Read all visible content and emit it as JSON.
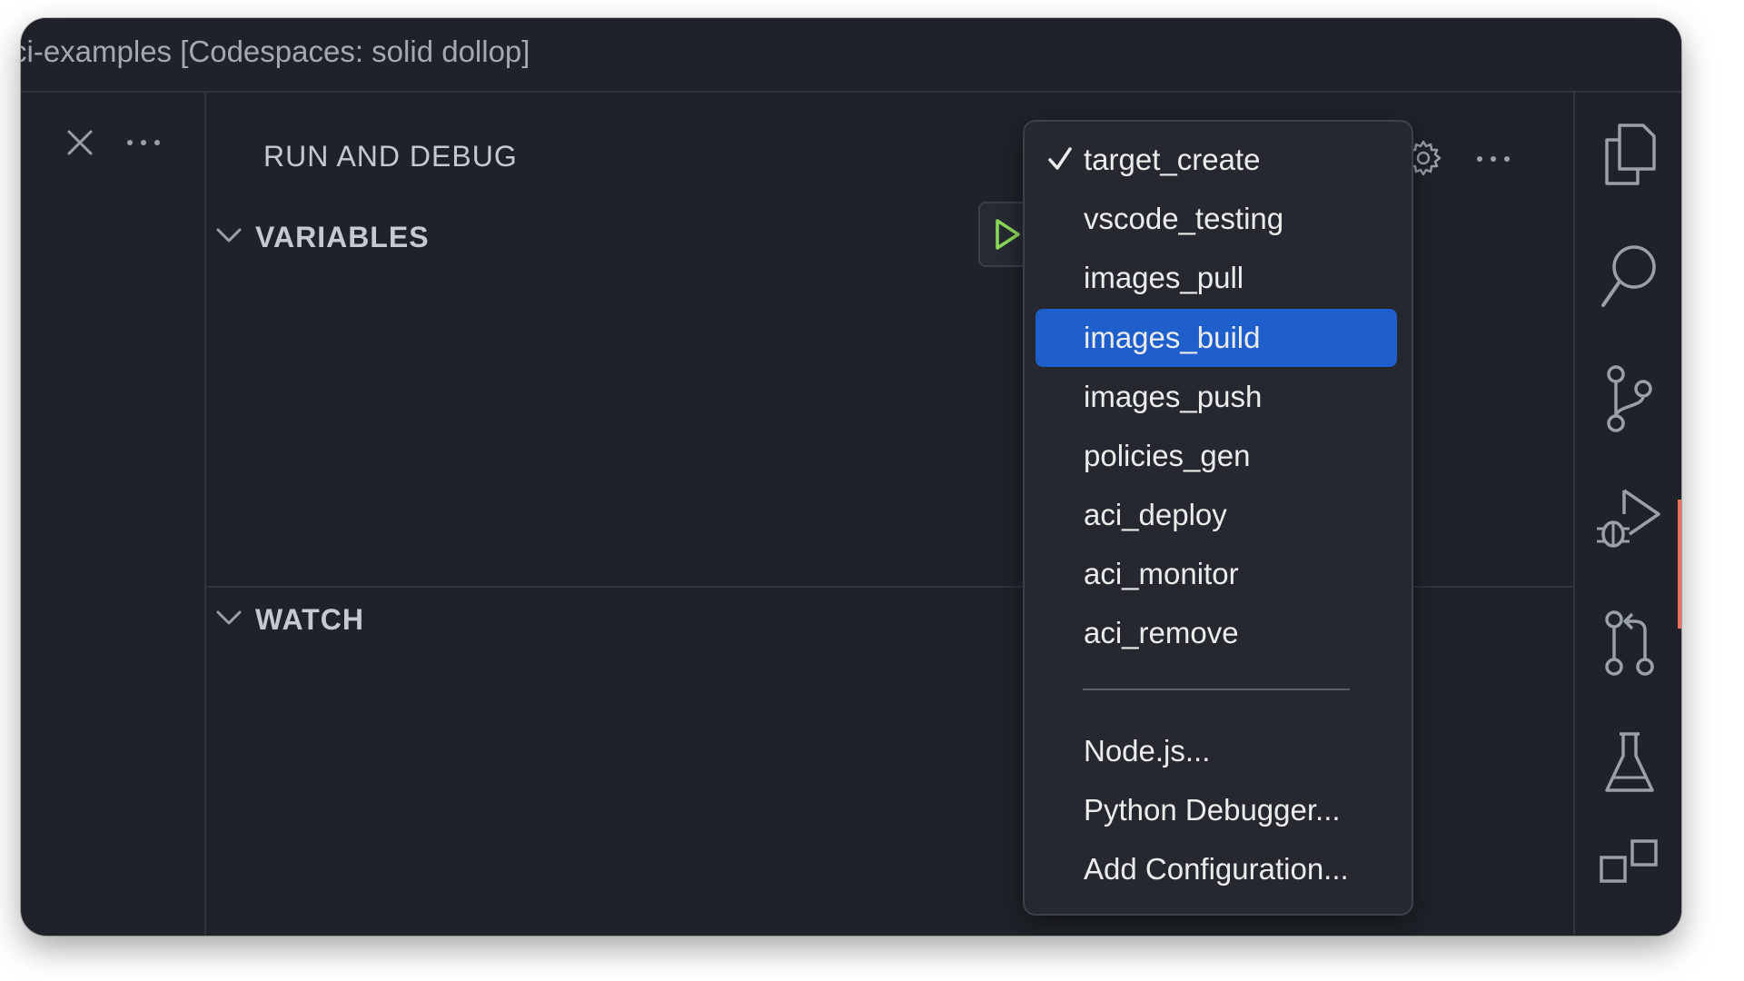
{
  "window": {
    "title": "ci-examples [Codespaces: solid dollop]"
  },
  "panel": {
    "title": "RUN AND DEBUG",
    "sections": [
      {
        "label": "VARIABLES",
        "expanded": true
      },
      {
        "label": "WATCH",
        "expanded": true
      }
    ]
  },
  "config_menu": {
    "checked_item": "target_create",
    "highlighted_item": "images_build",
    "items": [
      {
        "label": "target_create",
        "checked": true
      },
      {
        "label": "vscode_testing"
      },
      {
        "label": "images_pull"
      },
      {
        "label": "images_build",
        "highlighted": true
      },
      {
        "label": "images_push"
      },
      {
        "label": "policies_gen"
      },
      {
        "label": "aci_deploy"
      },
      {
        "label": "aci_monitor"
      },
      {
        "label": "aci_remove"
      }
    ],
    "extra_items": [
      {
        "label": "Node.js..."
      },
      {
        "label": "Python Debugger..."
      },
      {
        "label": "Add Configuration..."
      }
    ]
  },
  "activity_bar": {
    "items": [
      {
        "icon": "files-icon"
      },
      {
        "icon": "search-icon"
      },
      {
        "icon": "source-control-icon"
      },
      {
        "icon": "run-debug-icon",
        "active": true
      },
      {
        "icon": "pull-request-icon"
      },
      {
        "icon": "testing-icon"
      },
      {
        "icon": "extensions-icon"
      }
    ]
  },
  "colors": {
    "background": "#1f2329",
    "menu_background": "#25292f",
    "selection": "#1f5fcc",
    "run_icon": "#8ddc5a",
    "active_indicator": "#f0715b",
    "text": "#c5cad1"
  }
}
